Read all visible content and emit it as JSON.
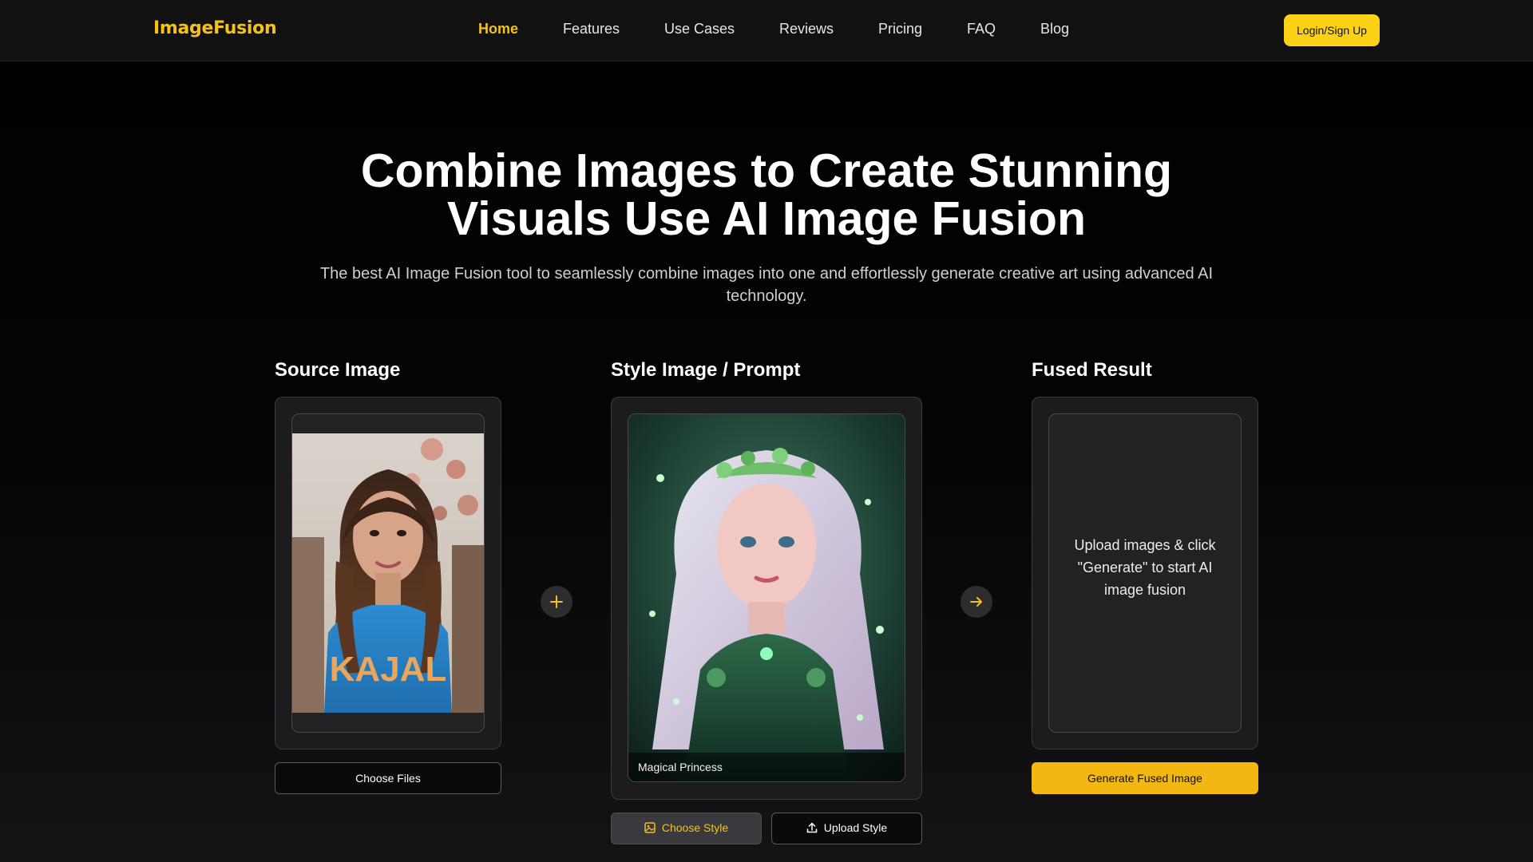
{
  "nav": {
    "logo": "ImageFusion",
    "links": [
      "Home",
      "Features",
      "Use Cases",
      "Reviews",
      "Pricing",
      "FAQ",
      "Blog"
    ],
    "active": "Home",
    "login_label": "Login/Sign Up"
  },
  "hero": {
    "title_line1": "Combine Images to Create Stunning",
    "title_line2": "Visuals Use AI Image Fusion",
    "subtitle_line1": "The best AI Image Fusion tool to seamlessly combine images into one and effortlessly generate creative art using advanced AI",
    "subtitle_line2": "technology."
  },
  "source": {
    "title": "Source Image",
    "shirt_text": "KAJAL",
    "choose_files_label": "Choose Files"
  },
  "style": {
    "title": "Style Image / Prompt",
    "caption": "Magical Princess",
    "choose_style_label": "Choose Style",
    "upload_style_label": "Upload Style"
  },
  "result": {
    "title": "Fused Result",
    "placeholder_line1": "Upload images & click",
    "placeholder_line2": "\"Generate\" to start AI",
    "placeholder_line3": "image fusion",
    "generate_label": "Generate Fused Image"
  },
  "icons": {
    "plus": "plus-icon",
    "arrow": "arrow-right-icon",
    "image": "image-icon",
    "upload": "upload-icon"
  },
  "colors": {
    "accent": "#f5c11b",
    "button_gold": "#f2b811",
    "login_button": "#fcd116",
    "background": "#000000",
    "card": "#1c1c1e"
  }
}
